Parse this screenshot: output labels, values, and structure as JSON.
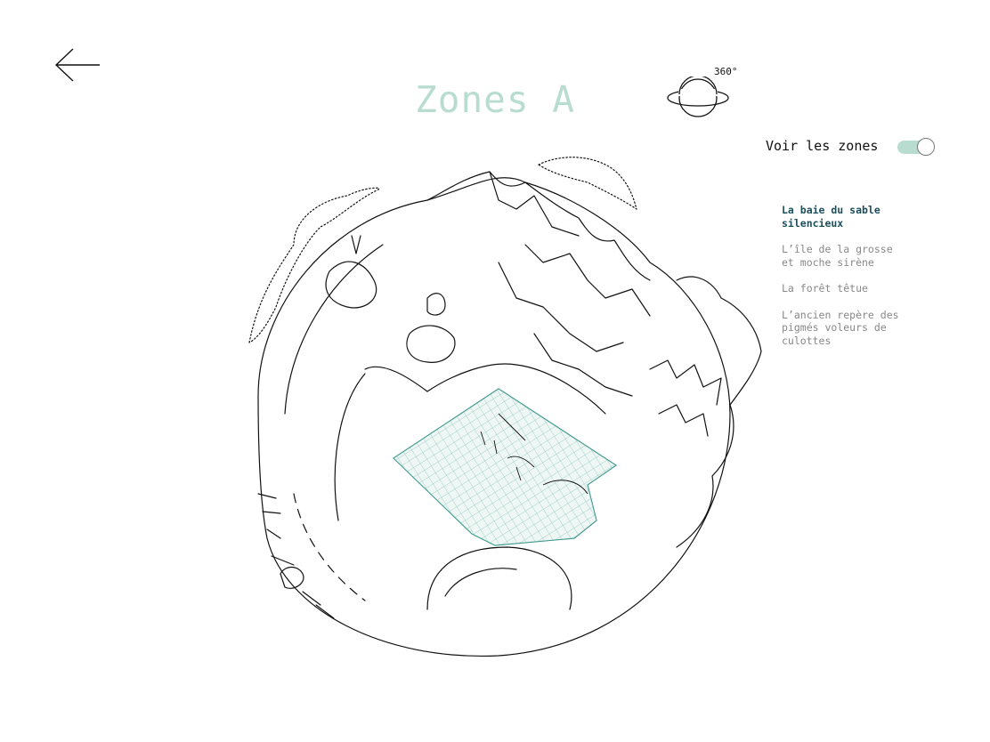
{
  "header": {
    "title": "Zones A",
    "view_360_label": "360°"
  },
  "toggle": {
    "label": "Voir les zones",
    "on": true
  },
  "zones": [
    {
      "label": "La baie du sable silencieux",
      "active": true
    },
    {
      "label": "L’île de la grosse et moche sirène",
      "active": false
    },
    {
      "label": "La forêt têtue",
      "active": false
    },
    {
      "label": "L’ancien repère des pigmés voleurs de culottes",
      "active": false
    }
  ],
  "colors": {
    "accent": "#b9dcd1",
    "active_zone_text": "#1d4f5a",
    "zone_overlay": "#2e8f84"
  },
  "icons": {
    "back": "arrow-left-icon",
    "view360": "planet-ring-icon"
  }
}
